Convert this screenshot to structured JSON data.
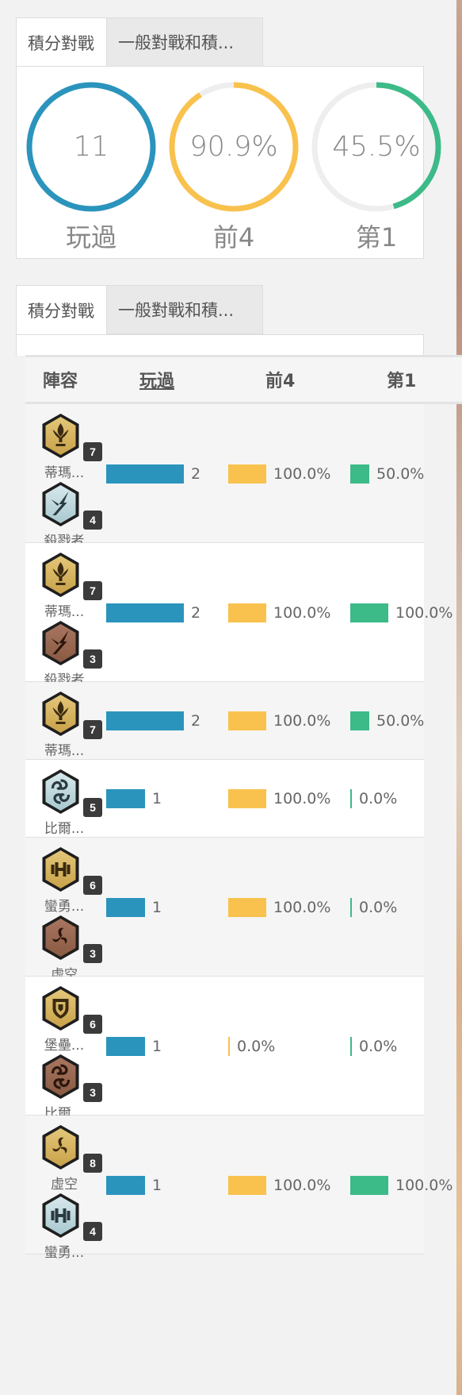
{
  "tabs": {
    "ranked": "積分對戰",
    "normal": "一般對戰和積..."
  },
  "summary": {
    "played": {
      "value": "11",
      "label": "玩過",
      "color": "#2b94bd",
      "fraction": 1.0
    },
    "top4": {
      "value": "90.9%",
      "label": "前4",
      "color": "#f9c24e",
      "fraction": 0.909
    },
    "first": {
      "value": "45.5%",
      "label": "第1",
      "color": "#3cba88",
      "fraction": 0.455
    }
  },
  "table": {
    "headers": {
      "comp": "陣容",
      "played": "玩過",
      "top4": "前4",
      "first": "第1"
    },
    "max_played": 2,
    "rows": [
      {
        "traits": [
          {
            "name": "蒂瑪...",
            "count": "7",
            "tier": "gold",
            "icon": "fleur-icon"
          },
          {
            "name": "殺戮者",
            "count": "4",
            "tier": "silver",
            "icon": "blade-icon"
          }
        ],
        "played": "2",
        "played_n": 2,
        "top4": "100.0%",
        "top4_frac": 1.0,
        "first": "50.0%",
        "first_frac": 0.5
      },
      {
        "traits": [
          {
            "name": "蒂瑪...",
            "count": "7",
            "tier": "gold",
            "icon": "fleur-icon"
          },
          {
            "name": "殺戮者",
            "count": "3",
            "tier": "bronze",
            "icon": "blade-icon"
          }
        ],
        "played": "2",
        "played_n": 2,
        "top4": "100.0%",
        "top4_frac": 1.0,
        "first": "100.0%",
        "first_frac": 1.0
      },
      {
        "traits": [
          {
            "name": "蒂瑪...",
            "count": "7",
            "tier": "gold",
            "icon": "fleur-icon"
          }
        ],
        "played": "2",
        "played_n": 2,
        "top4": "100.0%",
        "top4_frac": 1.0,
        "first": "50.0%",
        "first_frac": 0.5
      },
      {
        "traits": [
          {
            "name": "比爾...",
            "count": "5",
            "tier": "silver",
            "icon": "swirl-icon"
          }
        ],
        "played": "1",
        "played_n": 1,
        "top4": "100.0%",
        "top4_frac": 1.0,
        "first": "0.0%",
        "first_frac": 0.0
      },
      {
        "traits": [
          {
            "name": "蠻勇...",
            "count": "6",
            "tier": "gold",
            "icon": "dumbbell-icon"
          },
          {
            "name": "虛空",
            "count": "3",
            "tier": "bronze",
            "icon": "triskelion-icon"
          }
        ],
        "played": "1",
        "played_n": 1,
        "top4": "100.0%",
        "top4_frac": 1.0,
        "first": "0.0%",
        "first_frac": 0.0
      },
      {
        "traits": [
          {
            "name": "堡壘...",
            "count": "6",
            "tier": "gold",
            "icon": "shield-icon"
          },
          {
            "name": "比爾...",
            "count": "3",
            "tier": "bronze",
            "icon": "swirl-icon"
          }
        ],
        "played": "1",
        "played_n": 1,
        "top4": "0.0%",
        "top4_frac": 0.0,
        "first": "0.0%",
        "first_frac": 0.0
      },
      {
        "traits": [
          {
            "name": "虛空",
            "count": "8",
            "tier": "gold",
            "icon": "triskelion-icon"
          },
          {
            "name": "蠻勇...",
            "count": "4",
            "tier": "silver",
            "icon": "dumbbell-icon"
          }
        ],
        "played": "1",
        "played_n": 1,
        "top4": "100.0%",
        "top4_frac": 1.0,
        "first": "100.0%",
        "first_frac": 1.0
      }
    ]
  }
}
